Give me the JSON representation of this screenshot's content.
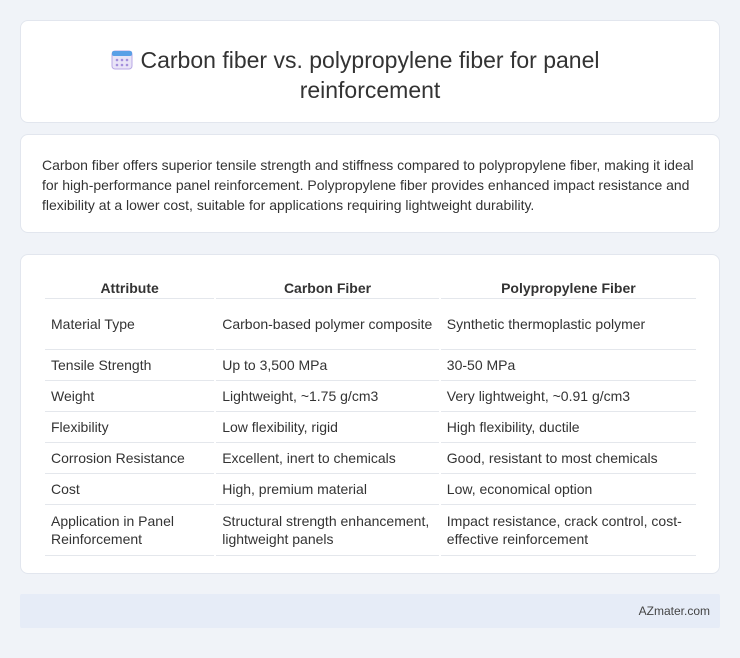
{
  "header": {
    "icon": "calendar-icon",
    "title": "Carbon fiber vs. polypropylene fiber for panel reinforcement"
  },
  "summary": {
    "text": "Carbon fiber offers superior tensile strength and stiffness compared to polypropylene fiber, making it ideal for high-performance panel reinforcement. Polypropylene fiber provides enhanced impact resistance and flexibility at a lower cost, suitable for applications requiring lightweight durability."
  },
  "table": {
    "headers": [
      "Attribute",
      "Carbon Fiber",
      "Polypropylene Fiber"
    ],
    "rows": [
      [
        "Material Type",
        "Carbon-based polymer composite",
        "Synthetic thermoplastic polymer"
      ],
      [
        "Tensile Strength",
        "Up to 3,500 MPa",
        "30-50 MPa"
      ],
      [
        "Weight",
        "Lightweight, ~1.75 g/cm3",
        "Very lightweight, ~0.91 g/cm3"
      ],
      [
        "Flexibility",
        "Low flexibility, rigid",
        "High flexibility, ductile"
      ],
      [
        "Corrosion Resistance",
        "Excellent, inert to chemicals",
        "Good, resistant to most chemicals"
      ],
      [
        "Cost",
        "High, premium material",
        "Low, economical option"
      ],
      [
        "Application in Panel Reinforcement",
        "Structural strength enhancement, lightweight panels",
        "Impact resistance, crack control, cost-effective reinforcement"
      ]
    ]
  },
  "footer": {
    "brand": "AZmater.com"
  }
}
